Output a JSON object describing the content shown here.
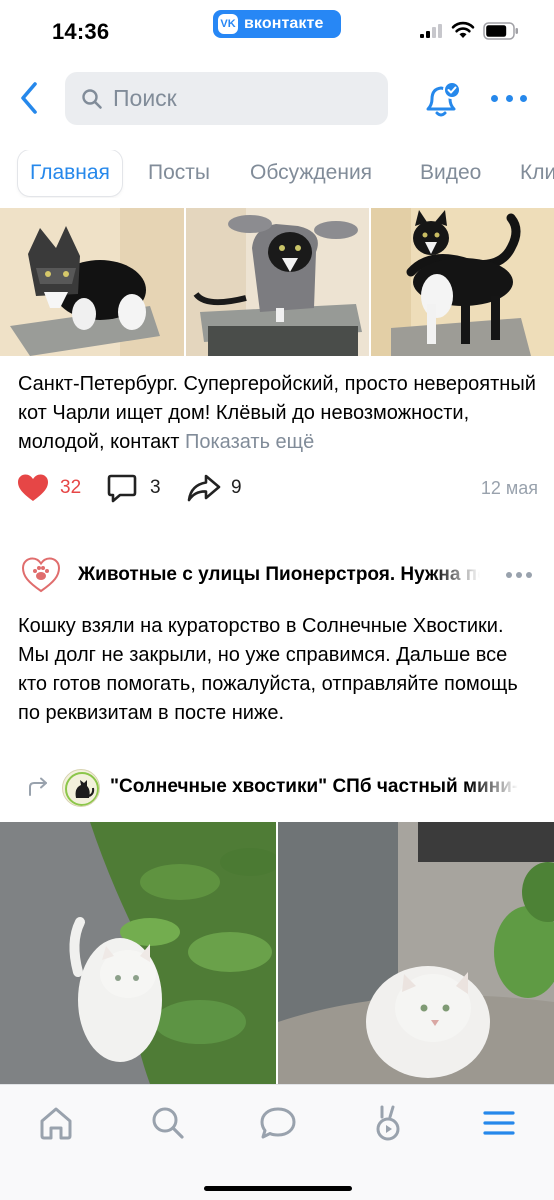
{
  "status_bar": {
    "time": "14:36",
    "app_badge": "вконтакте",
    "app_badge_logo": "VK"
  },
  "topnav": {
    "back_icon": "chevron-left-icon",
    "search_placeholder": "Поиск",
    "bell_icon": "bell-icon",
    "more_icon": "more-horizontal-icon"
  },
  "tabs": [
    "Главная",
    "Посты",
    "Обсуждения",
    "Видео",
    "Кли"
  ],
  "post1": {
    "text": "Санкт-Петербург. Супергеройский, просто невероятный кот Чарли ищет дом! Клёвый до невозможности, молодой, контакт ",
    "show_more": "Показать ещё",
    "likes": "32",
    "comments": "3",
    "shares": "9",
    "date": "12 мая"
  },
  "post2": {
    "group_name": "Животные с улицы Пионерстроя. Нужна помощь",
    "text": "Кошку взяли на кураторство в Солнечные Хвостики. Мы долг не закрыли, но уже справимся. Дальше все кто готов помогать, пожалуйста, отправляйте помощь по реквизитам в посте ниже.",
    "repost_name": "\"Солнечные хвостики\" СПб частный мини-приют"
  },
  "tabbar": [
    "home-icon",
    "search-icon",
    "messages-icon",
    "clips-icon",
    "menu-icon"
  ],
  "colors": {
    "accent": "#2688EB",
    "vk_blue": "#2787F5",
    "like_red": "#E64646",
    "secondary_text": "#818C99",
    "search_bg": "#EBEDF0"
  }
}
